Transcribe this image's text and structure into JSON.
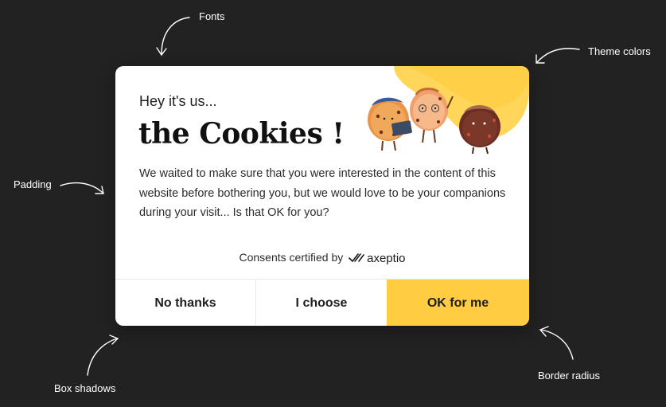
{
  "annotations": {
    "fonts": "Fonts",
    "theme_colors": "Theme colors",
    "padding": "Padding",
    "box_shadows": "Box shadows",
    "border_radius": "Border radius"
  },
  "banner": {
    "greeting": "Hey it's us...",
    "title": "the Cookies !",
    "body": "We waited to make sure that you were interested in the content of this website before bothering you, but we would love to be your companions during your visit... Is that OK for you?",
    "certified_label": "Consents certified by",
    "brand": "axeptio",
    "buttons": {
      "no_thanks": "No thanks",
      "i_choose": "I choose",
      "ok_for_me": "OK for me"
    }
  },
  "colors": {
    "page_background": "#222222",
    "banner_background": "#ffffff",
    "accent": "#ffcc42",
    "text": "#1f1f1f"
  },
  "icons": [
    "cookie-characters-illustration",
    "axeptio-logo-icon",
    "annotation-arrow-icon"
  ]
}
